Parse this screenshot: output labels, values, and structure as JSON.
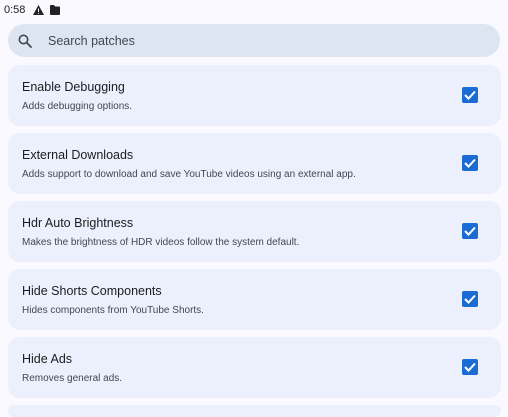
{
  "status_bar": {
    "time": "0:58",
    "icons": [
      "warning-icon",
      "sd-card-icon"
    ]
  },
  "search": {
    "placeholder": "Search patches"
  },
  "patches": [
    {
      "title": "Enable Debugging",
      "description": "Adds debugging options.",
      "checked": true
    },
    {
      "title": "External Downloads",
      "description": "Adds support to download and save YouTube videos using an external app.",
      "checked": true
    },
    {
      "title": "Hdr Auto Brightness",
      "description": "Makes the brightness of HDR videos follow the system default.",
      "checked": true
    },
    {
      "title": "Hide Shorts Components",
      "description": "Hides components from YouTube Shorts.",
      "checked": true
    },
    {
      "title": "Hide Ads",
      "description": "Removes general ads.",
      "checked": true
    }
  ],
  "colors": {
    "accent": "#1a6bd3",
    "card": "#ecf0fc",
    "search_bg": "#dde4f2",
    "background": "#f9f9ff"
  }
}
